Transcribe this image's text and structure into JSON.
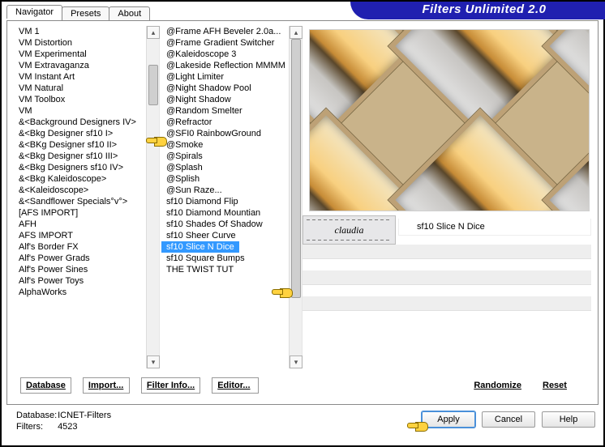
{
  "app": {
    "title": "Filters Unlimited 2.0"
  },
  "tabs": [
    {
      "label": "Navigator",
      "active": true
    },
    {
      "label": "Presets",
      "active": false
    },
    {
      "label": "About",
      "active": false
    }
  ],
  "category_list": [
    "VM 1",
    "VM Distortion",
    "VM Experimental",
    "VM Extravaganza",
    "VM Instant Art",
    "VM Natural",
    "VM Toolbox",
    "VM",
    "&<Background Designers IV>",
    "&<Bkg Designer sf10 I>",
    "&<BKg Designer sf10 II>",
    "&<Bkg Designer sf10 III>",
    "&<Bkg Designers sf10 IV>",
    "&<Bkg Kaleidoscope>",
    "&<Kaleidoscope>",
    "&<Sandflower Specials°v°>",
    "[AFS IMPORT]",
    "AFH",
    "AFS IMPORT",
    "Alf's Border FX",
    "Alf's Power Grads",
    "Alf's Power Sines",
    "Alf's Power Toys",
    "AlphaWorks"
  ],
  "category_pointer_index": 8,
  "filter_list": [
    "@Frame AFH Beveler 2.0a...",
    "@Frame Gradient Switcher",
    "@Kaleidoscope 3",
    "@Lakeside Reflection MMMM",
    "@Light Limiter",
    "@Night Shadow Pool",
    "@Night Shadow",
    "@Random Smelter",
    "@Refractor",
    "@SFI0 RainbowGround",
    "@Smoke",
    "@Spirals",
    "@Splash",
    "@Splish",
    "@Sun Raze...",
    "sf10 Diamond Flip",
    "sf10 Diamond Mountian",
    "sf10 Shades Of Shadow",
    "sf10 Sheer Curve",
    "sf10 Slice N Dice",
    "sf10 Square Bumps",
    "THE TWIST TUT"
  ],
  "filter_selected_index": 19,
  "signature": "claudia",
  "selected_filter_name": "sf10 Slice N Dice",
  "linkbar": {
    "database": "Database",
    "import": "Import...",
    "filter_info": "Filter Info...",
    "editor": "Editor...",
    "randomize": "Randomize",
    "reset": "Reset"
  },
  "status": {
    "db_label": "Database:",
    "db_value": "ICNET-Filters",
    "filters_label": "Filters:",
    "filters_value": "4523"
  },
  "buttons": {
    "apply": "Apply",
    "cancel": "Cancel",
    "help": "Help"
  }
}
